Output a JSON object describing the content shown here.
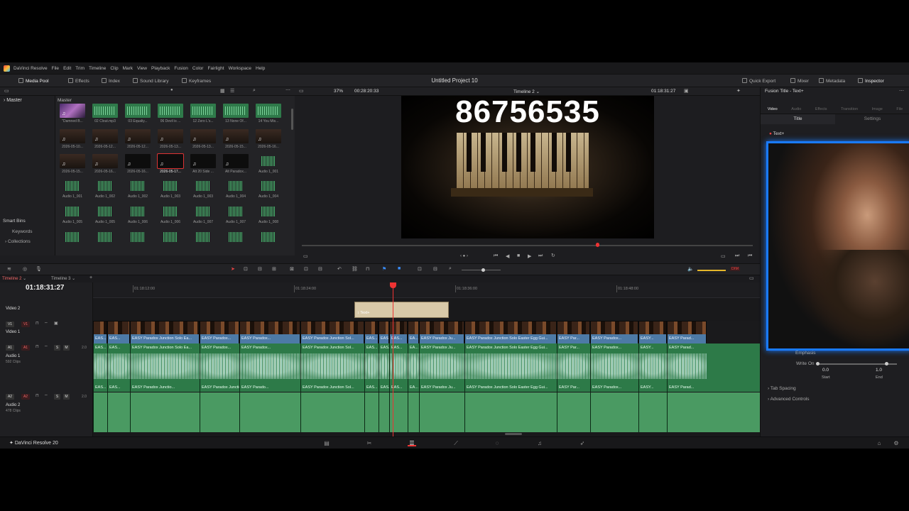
{
  "menubar": {
    "app": "DaVinci Resolve",
    "items": [
      "File",
      "Edit",
      "Trim",
      "Timeline",
      "Clip",
      "Mark",
      "View",
      "Playback",
      "Fusion",
      "Color",
      "Fairlight",
      "Workspace",
      "Help"
    ]
  },
  "toolbar": {
    "media_pool": "Media Pool",
    "effects": "Effects",
    "index": "Index",
    "sound_library": "Sound Library",
    "keyframes": "Keyframes",
    "project_title": "Untitled Project 10",
    "quick_export": "Quick Export",
    "mixer": "Mixer",
    "metadata": "Metadata",
    "inspector": "Inspector"
  },
  "media_pool": {
    "master_bin": "Master",
    "header": "Master",
    "smart_bins": "Smart Bins",
    "keywords": "Keywords",
    "collections": "Collections",
    "clips": [
      {
        "label": "\"Damned B...",
        "kind": "purp"
      },
      {
        "label": "02 Clout.mp3",
        "kind": "aud"
      },
      {
        "label": "03 Equaliy...",
        "kind": "aud"
      },
      {
        "label": "06 Devil is ...",
        "kind": "aud"
      },
      {
        "label": "12 Zero L's...",
        "kind": "aud"
      },
      {
        "label": "13 None Of...",
        "kind": "aud"
      },
      {
        "label": "14 You Mis...",
        "kind": "aud"
      },
      {
        "label": "2026-05-10...",
        "kind": "vid"
      },
      {
        "label": "2026-05-12...",
        "kind": "vid"
      },
      {
        "label": "2026-05-12...",
        "kind": "vid"
      },
      {
        "label": "2026-05-13...",
        "kind": "vid"
      },
      {
        "label": "2026-05-13...",
        "kind": "vid"
      },
      {
        "label": "2026-05-15...",
        "kind": "vid"
      },
      {
        "label": "2026-05-16...",
        "kind": "vid"
      },
      {
        "label": "2026-05-15...",
        "kind": "vid"
      },
      {
        "label": "2026-05-16...",
        "kind": "vid"
      },
      {
        "label": "2026-05-16...",
        "kind": "dark"
      },
      {
        "label": "2026-05-17...",
        "kind": "dark",
        "selected": true
      },
      {
        "label": "Alt 20 Side ...",
        "kind": "dark"
      },
      {
        "label": "Alt Paradox...",
        "kind": "dark"
      },
      {
        "label": "Audio 1_001",
        "kind": "wave"
      },
      {
        "label": "Audio 1_001",
        "kind": "wave"
      },
      {
        "label": "Audio 1_002",
        "kind": "wave"
      },
      {
        "label": "Audio 1_002",
        "kind": "wave"
      },
      {
        "label": "Audio 1_003",
        "kind": "wave"
      },
      {
        "label": "Audio 1_003",
        "kind": "wave"
      },
      {
        "label": "Audio 1_004",
        "kind": "wave"
      },
      {
        "label": "Audio 1_004",
        "kind": "wave"
      },
      {
        "label": "Audio 1_005",
        "kind": "wave"
      },
      {
        "label": "Audio 1_005",
        "kind": "wave"
      },
      {
        "label": "Audio 1_006",
        "kind": "wave"
      },
      {
        "label": "Audio 1_006",
        "kind": "wave"
      },
      {
        "label": "Audio 1_007",
        "kind": "wave"
      },
      {
        "label": "Audio 1_007",
        "kind": "wave"
      },
      {
        "label": "Audio 1_008",
        "kind": "wave"
      },
      {
        "label": "",
        "kind": "wave"
      },
      {
        "label": "",
        "kind": "wave"
      },
      {
        "label": "",
        "kind": "wave"
      },
      {
        "label": "",
        "kind": "wave"
      },
      {
        "label": "",
        "kind": "wave"
      },
      {
        "label": "",
        "kind": "wave"
      },
      {
        "label": "",
        "kind": "wave"
      }
    ]
  },
  "viewer": {
    "zoom": "37%",
    "source_tc": "00:28:20:33",
    "timeline_name": "Timeline 2",
    "record_tc": "01:18:31:27",
    "overlay_number": "86756535"
  },
  "timeline": {
    "tabs": [
      "Timeline 2",
      "Timeline 3"
    ],
    "timecode": "01:18:31:27",
    "ruler": [
      "01:18:12:00",
      "01:18:24:00",
      "01:18:36:00",
      "01:18:48:00"
    ],
    "title_clip": "Text+",
    "tracks": {
      "video2": "Video 2",
      "v1": "V1",
      "v1_name": "Video 1",
      "a1": "A1",
      "a1_name": "Audio 1",
      "a1_sub": "592 Clips",
      "a1_level": "2.0",
      "a2": "A2",
      "a2_name": "Audio 2",
      "a2_sub": "478 Clips",
      "a2_level": "2.0"
    },
    "v1_clips": [
      "EAS...",
      "EAS...",
      "EASY Paradox Junction Solo Ea...",
      "EASY Paradox...",
      "EASY Paradox...",
      "EASY Paradox Junction Sol...",
      "EAS...",
      "EAS...",
      "EAS...",
      "EA...",
      "EASY Paradox Ju...",
      "EASY Paradox Junction Solo Easter Egg Gui...",
      "EASY Par...",
      "EASY Paradox...",
      "EASY...",
      "EASY Parad..."
    ],
    "a1_clips": [
      "EAS...",
      "EAS...",
      "EASY Paradox Junctio...",
      "EASY Paradox Junction Solo Ea...",
      "EASY Parado...",
      "EASY Paradox Junction Sol...",
      "EAS...",
      "EAS...",
      "EAS...",
      "EA...",
      "EASY Paradox Ju...",
      "EASY Paradox Junction Solo Easter Egg Gui...",
      "EASY Par...",
      "EASY Paradox...",
      "EASY...",
      "EASY Parad..."
    ],
    "dim_label": "DIM"
  },
  "inspector": {
    "title": "Fusion Title - Text+",
    "tabs": [
      "Video",
      "Audio",
      "Effects",
      "Transition",
      "Image",
      "File"
    ],
    "subtabs": [
      "Title",
      "Settings"
    ],
    "section": "Text+",
    "emphasis": "Emphasis",
    "write_on": "Write On",
    "start_value": "0.0",
    "end_value": "1.0",
    "start_label": "Start",
    "end_label": "End",
    "tab_spacing": "Tab Spacing",
    "advanced_controls": "Advanced Controls"
  },
  "statusbar": {
    "app_version": "DaVinci Resolve 20"
  },
  "colors": {
    "accent_red": "#e33333",
    "video_clip_blue": "#4d7aa6",
    "audio_green": "#2d7a48",
    "webcam_border": "#1a7bff"
  }
}
